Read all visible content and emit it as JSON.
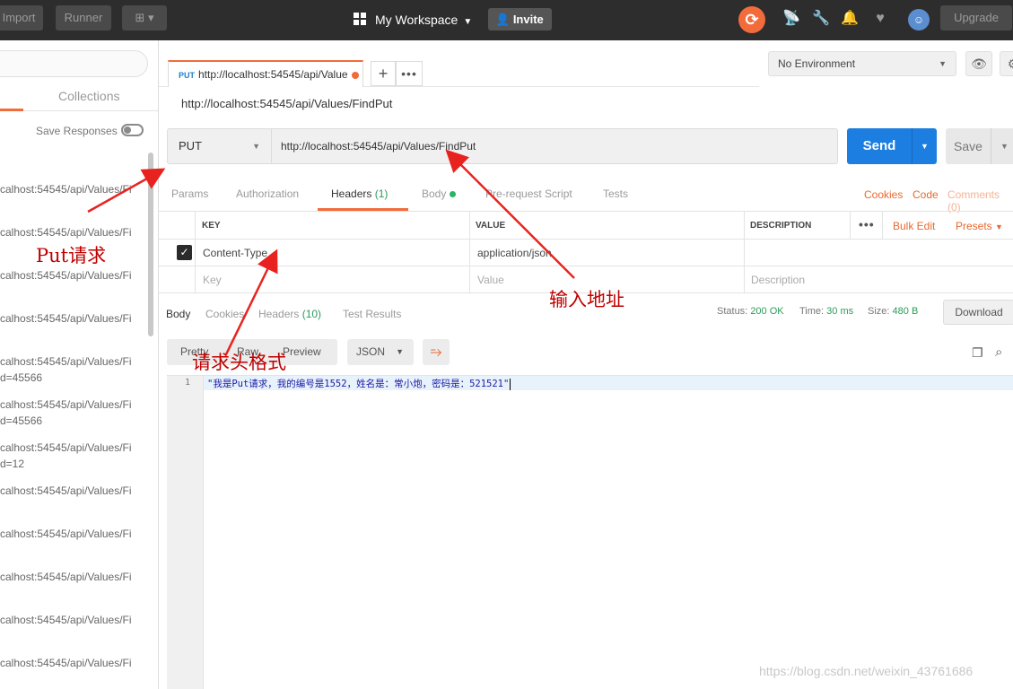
{
  "topbar": {
    "import_label": "Import",
    "runner_label": "Runner",
    "workspace_label": "My Workspace",
    "invite_label": "Invite",
    "upgrade_label": "Upgrade"
  },
  "sidebar": {
    "collections_label": "Collections",
    "save_responses_label": "Save Responses",
    "history": [
      {
        "l1": "calhost:54545/api/Values/Fi",
        "l2": ""
      },
      {
        "l1": "calhost:54545/api/Values/Fi",
        "l2": ""
      },
      {
        "l1": "calhost:54545/api/Values/Fi",
        "l2": ""
      },
      {
        "l1": "calhost:54545/api/Values/Fi",
        "l2": ""
      },
      {
        "l1": "calhost:54545/api/Values/Fi",
        "l2": "d=45566"
      },
      {
        "l1": "calhost:54545/api/Values/Fi",
        "l2": "d=45566"
      },
      {
        "l1": "calhost:54545/api/Values/Fi",
        "l2": "d=12"
      },
      {
        "l1": "calhost:54545/api/Values/Fi",
        "l2": ""
      },
      {
        "l1": "calhost:54545/api/Values/Fi",
        "l2": ""
      },
      {
        "l1": "calhost:54545/api/Values/Fi",
        "l2": ""
      },
      {
        "l1": "calhost:54545/api/Values/Fi",
        "l2": ""
      },
      {
        "l1": "calhost:54545/api/Values/Fi",
        "l2": ""
      }
    ]
  },
  "request_tab": {
    "method": "PUT",
    "title": "http://localhost:54545/api/Value"
  },
  "environment": {
    "selected": "No Environment"
  },
  "request": {
    "name": "http://localhost:54545/api/Values/FindPut",
    "method": "PUT",
    "url": "http://localhost:54545/api/Values/FindPut",
    "send_label": "Send",
    "save_label": "Save"
  },
  "request_tabs": {
    "params": "Params",
    "authorization": "Authorization",
    "headers": "Headers",
    "headers_count": "(1)",
    "body": "Body",
    "prerequest": "Pre-request Script",
    "tests": "Tests",
    "cookies": "Cookies",
    "code": "Code",
    "comments": "Comments (0)"
  },
  "headers_table": {
    "col_key": "KEY",
    "col_value": "VALUE",
    "col_description": "DESCRIPTION",
    "bulk_edit": "Bulk Edit",
    "presets": "Presets",
    "row": {
      "key": "Content-Type",
      "value": "application/json"
    },
    "placeholder": {
      "key": "Key",
      "value": "Value",
      "description": "Description"
    }
  },
  "response_tabs": {
    "body": "Body",
    "cookies": "Cookies",
    "headers": "Headers",
    "headers_count": "(10)",
    "test_results": "Test Results"
  },
  "response_meta": {
    "status_label": "Status:",
    "status_value": "200 OK",
    "time_label": "Time:",
    "time_value": "30 ms",
    "size_label": "Size:",
    "size_value": "480 B",
    "download_label": "Download"
  },
  "response_view": {
    "pretty": "Pretty",
    "raw": "Raw",
    "preview": "Preview",
    "format": "JSON"
  },
  "editor": {
    "line_number": "1",
    "content": "\"我是Put请求，我的编号是1552，姓名是：常小炮，密码是：521521\""
  },
  "annotations": {
    "put": "Put请求",
    "address": "输入地址",
    "header_format": "请求头格式",
    "color": "#c00000"
  },
  "watermark": "https://blog.csdn.net/weixin_43761686",
  "colors": {
    "accent": "#f26b3a",
    "send_blue": "#1c7ee0",
    "status_green": "#2c9b5a",
    "topbar": "#2d2d2d"
  }
}
